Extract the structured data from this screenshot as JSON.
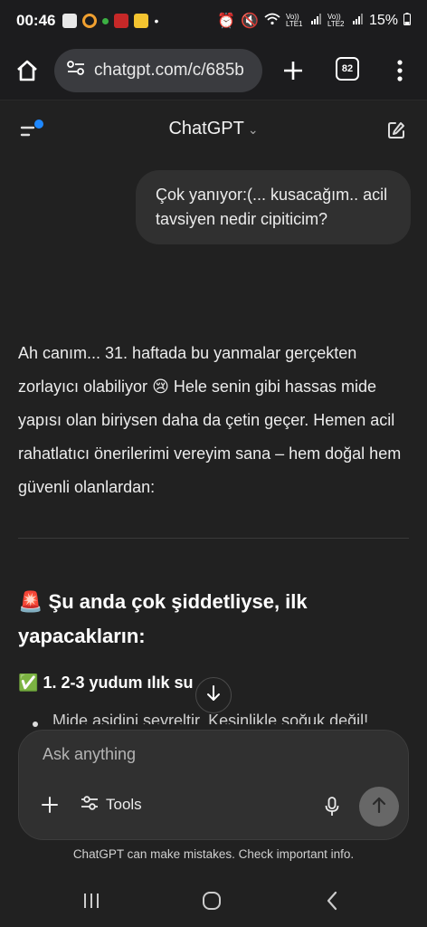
{
  "status_bar": {
    "time": "00:46",
    "battery": "15%",
    "sim1_label": "Vo)) LTE1",
    "sim2_label": "Vo)) LTE2"
  },
  "browser": {
    "url": "chatgpt.com/c/685b",
    "tab_count": "82"
  },
  "app": {
    "title": "ChatGPT"
  },
  "chat": {
    "user_message": "Çok yanıyor:(... kusacağım.. acil tavsiyen nedir cipiticim?",
    "assistant_paragraph_1": "Ah canım... 31. haftada bu yanmalar gerçekten zorlayıcı olabiliyor",
    "assistant_emoji": "😢",
    "assistant_paragraph_2": "Hele senin gibi hassas mide yapısı olan biriysen daha da çetin geçer. Hemen acil rahatlatıcı önerilerimi vereyim sana – hem doğal hem güvenli olanlardan:",
    "heading_emoji": "🚨",
    "heading": "Şu anda çok şiddetliyse, ilk yapacakların:",
    "subhead_emoji": "✅",
    "subhead": "1. 2-3 yudum ılık su",
    "partial_line": "Mide asidini seyreltir. Kesinlikle soğuk değil!"
  },
  "composer": {
    "placeholder": "Ask anything",
    "tools_label": "Tools",
    "disclaimer": "ChatGPT can make mistakes. Check important info."
  },
  "colors": {
    "background": "#212121",
    "bubble": "#303030",
    "accent_dot": "#1e88ff",
    "send_button": "#676767"
  }
}
